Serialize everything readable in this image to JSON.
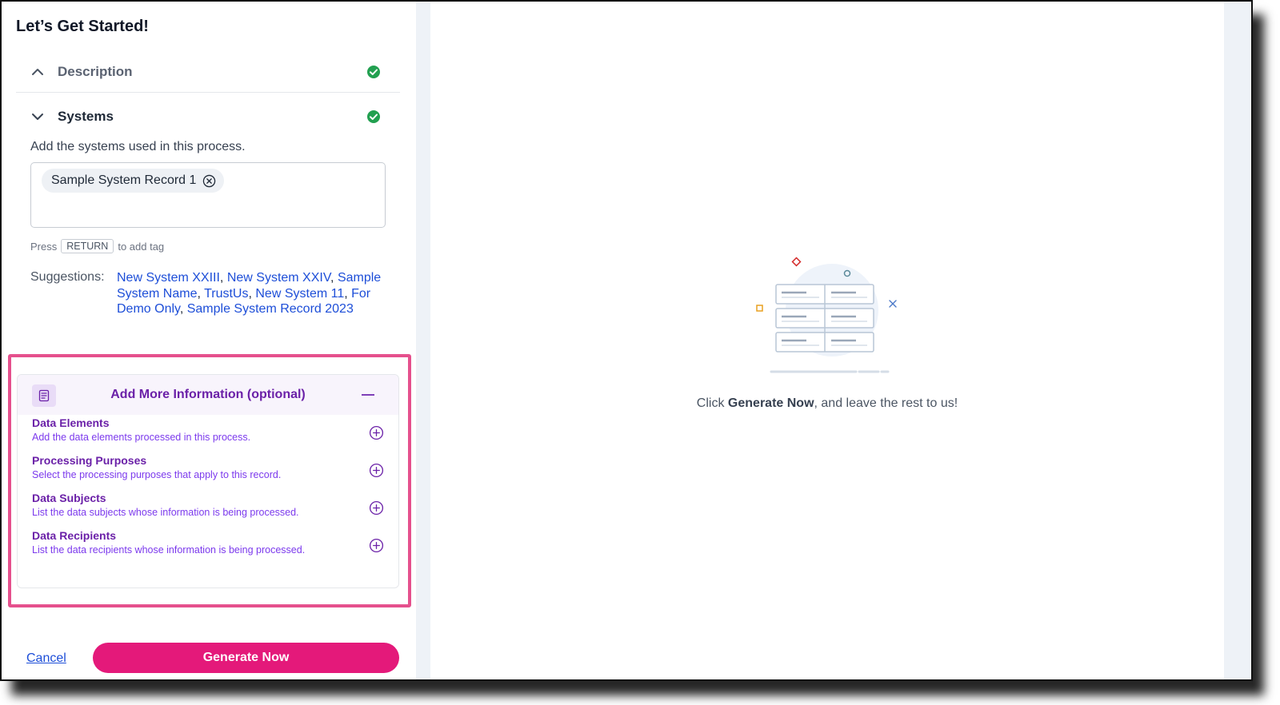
{
  "page": {
    "title": "Let’s Get Started!"
  },
  "sections": {
    "description": {
      "label": "Description",
      "complete": true
    },
    "systems": {
      "label": "Systems",
      "complete": true,
      "help": "Add the systems used in this process.",
      "tags": [
        "Sample System Record 1"
      ],
      "hint": {
        "press": "Press",
        "key": "RETURN",
        "after": "to add tag"
      },
      "suggestions_label": "Suggestions:",
      "suggestions": [
        "New System XXIII",
        "New System XXIV",
        "Sample System Name",
        "TrustUs",
        "New System 11",
        "For Demo Only",
        "Sample System Record 2023"
      ]
    }
  },
  "more_info": {
    "title": "Add More Information (optional)",
    "items": [
      {
        "title": "Data Elements",
        "desc": "Add the data elements processed in this process."
      },
      {
        "title": "Processing Purposes",
        "desc": "Select the processing purposes that apply to this record."
      },
      {
        "title": "Data Subjects",
        "desc": "List the data subjects whose information is being processed."
      },
      {
        "title": "Data Recipients",
        "desc": "List the data recipients whose information is being processed."
      }
    ]
  },
  "footer": {
    "cancel": "Cancel",
    "generate": "Generate Now"
  },
  "empty_state": {
    "prefix": "Click",
    "bold": "Generate Now",
    "suffix": ", and leave the rest to us!"
  },
  "colors": {
    "accent_pink": "#e4197a",
    "highlight_border": "#e5508d",
    "purple": "#6b21a8",
    "link_blue": "#1d4ed8",
    "success_green": "#22a050"
  },
  "icons": {
    "collapse": "chevron-up-icon",
    "expand": "chevron-down-icon",
    "complete": "check-circle-icon",
    "remove_tag": "close-circle-icon",
    "add": "plus-circle-icon",
    "minimize": "minus-icon",
    "card": "document-icon"
  }
}
